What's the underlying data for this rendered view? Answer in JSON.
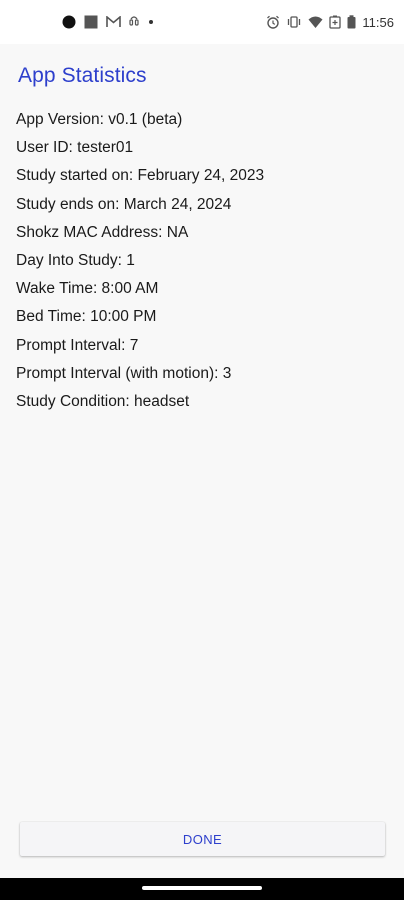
{
  "status_bar": {
    "time": "11:56",
    "left_icons": [
      "record-dot-icon",
      "square-app-icon",
      "gmail-icon",
      "headset-icon",
      "notification-dot-icon"
    ],
    "right_icons": [
      "alarm-icon",
      "vibrate-icon",
      "wifi-icon",
      "battery-saver-icon",
      "battery-icon"
    ]
  },
  "page": {
    "title": "App Statistics"
  },
  "stats": {
    "app_version": "App Version: v0.1 (beta)",
    "user_id": "User ID: tester01",
    "study_started": "Study started on: February 24, 2023",
    "study_ends": "Study ends on: March 24, 2024",
    "shokz_mac": "Shokz MAC Address: NA",
    "day_into_study": "Day Into Study: 1",
    "wake_time": "Wake Time: 8:00 AM",
    "bed_time": "Bed Time: 10:00 PM",
    "prompt_interval": "Prompt Interval: 7",
    "prompt_interval_motion": "Prompt Interval (with motion): 3",
    "study_condition": "Study Condition: headset"
  },
  "actions": {
    "done_label": "DONE"
  },
  "colors": {
    "accent": "#2d3fcc",
    "background": "#f8f8f8",
    "status_bar": "#ffffff",
    "nav_bar": "#000000"
  }
}
